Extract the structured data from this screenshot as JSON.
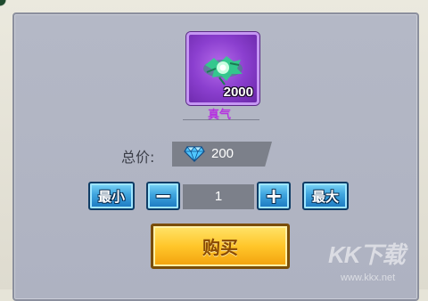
{
  "item": {
    "name": "真气",
    "count": "2000",
    "icon": "green-qi-orb-icon",
    "rarity_color": "#b531e0"
  },
  "price": {
    "label": "总价:",
    "currency_icon": "diamond-icon",
    "value": "200"
  },
  "quantity": {
    "min_label": "最小",
    "decrement_label": "−",
    "value": "1",
    "increment_label": "+",
    "max_label": "最大"
  },
  "buy": {
    "label": "购买"
  },
  "watermark": {
    "logo": "KK下载",
    "url": "www.kkx.net"
  },
  "colors": {
    "panel": "#b4b8c6",
    "button_blue": "#3ea4de",
    "button_gold": "#ffc62a"
  }
}
